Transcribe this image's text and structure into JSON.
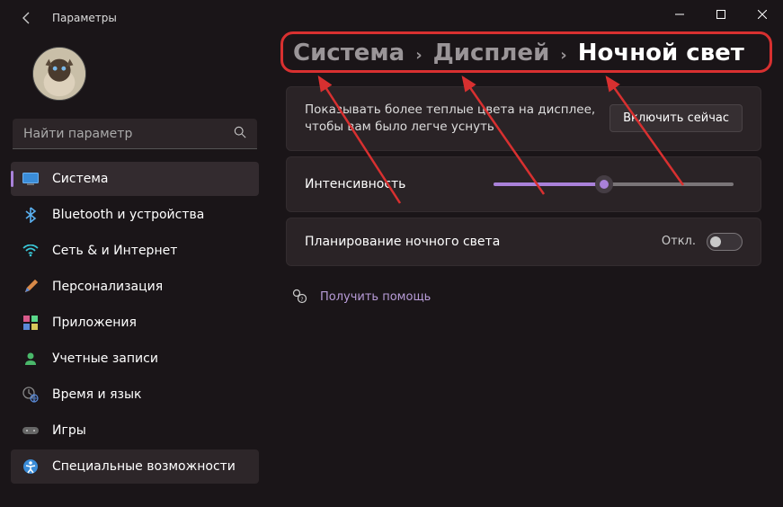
{
  "window": {
    "title": "Параметры"
  },
  "search": {
    "placeholder": "Найти параметр"
  },
  "nav": {
    "items": [
      {
        "label": "Система"
      },
      {
        "label": "Bluetooth и устройства"
      },
      {
        "label": "Сеть & и Интернет"
      },
      {
        "label": "Персонализация"
      },
      {
        "label": "Приложения"
      },
      {
        "label": "Учетные записи"
      },
      {
        "label": "Время и язык"
      },
      {
        "label": "Игры"
      },
      {
        "label": "Специальные возможности"
      }
    ]
  },
  "breadcrumb": {
    "part1": "Система",
    "part2": "Дисплей",
    "current": "Ночной свет"
  },
  "cards": {
    "warm_desc": "Показывать более теплые цвета на дисплее, чтобы вам было легче уснуть",
    "enable_btn": "Включить сейчас",
    "intensity_label": "Интенсивность",
    "schedule_label": "Планирование ночного света",
    "schedule_state": "Откл."
  },
  "help": {
    "label": "Получить помощь"
  },
  "slider": {
    "percent": 46
  },
  "colors": {
    "accent": "#a981d9",
    "annotation": "#d83030"
  }
}
